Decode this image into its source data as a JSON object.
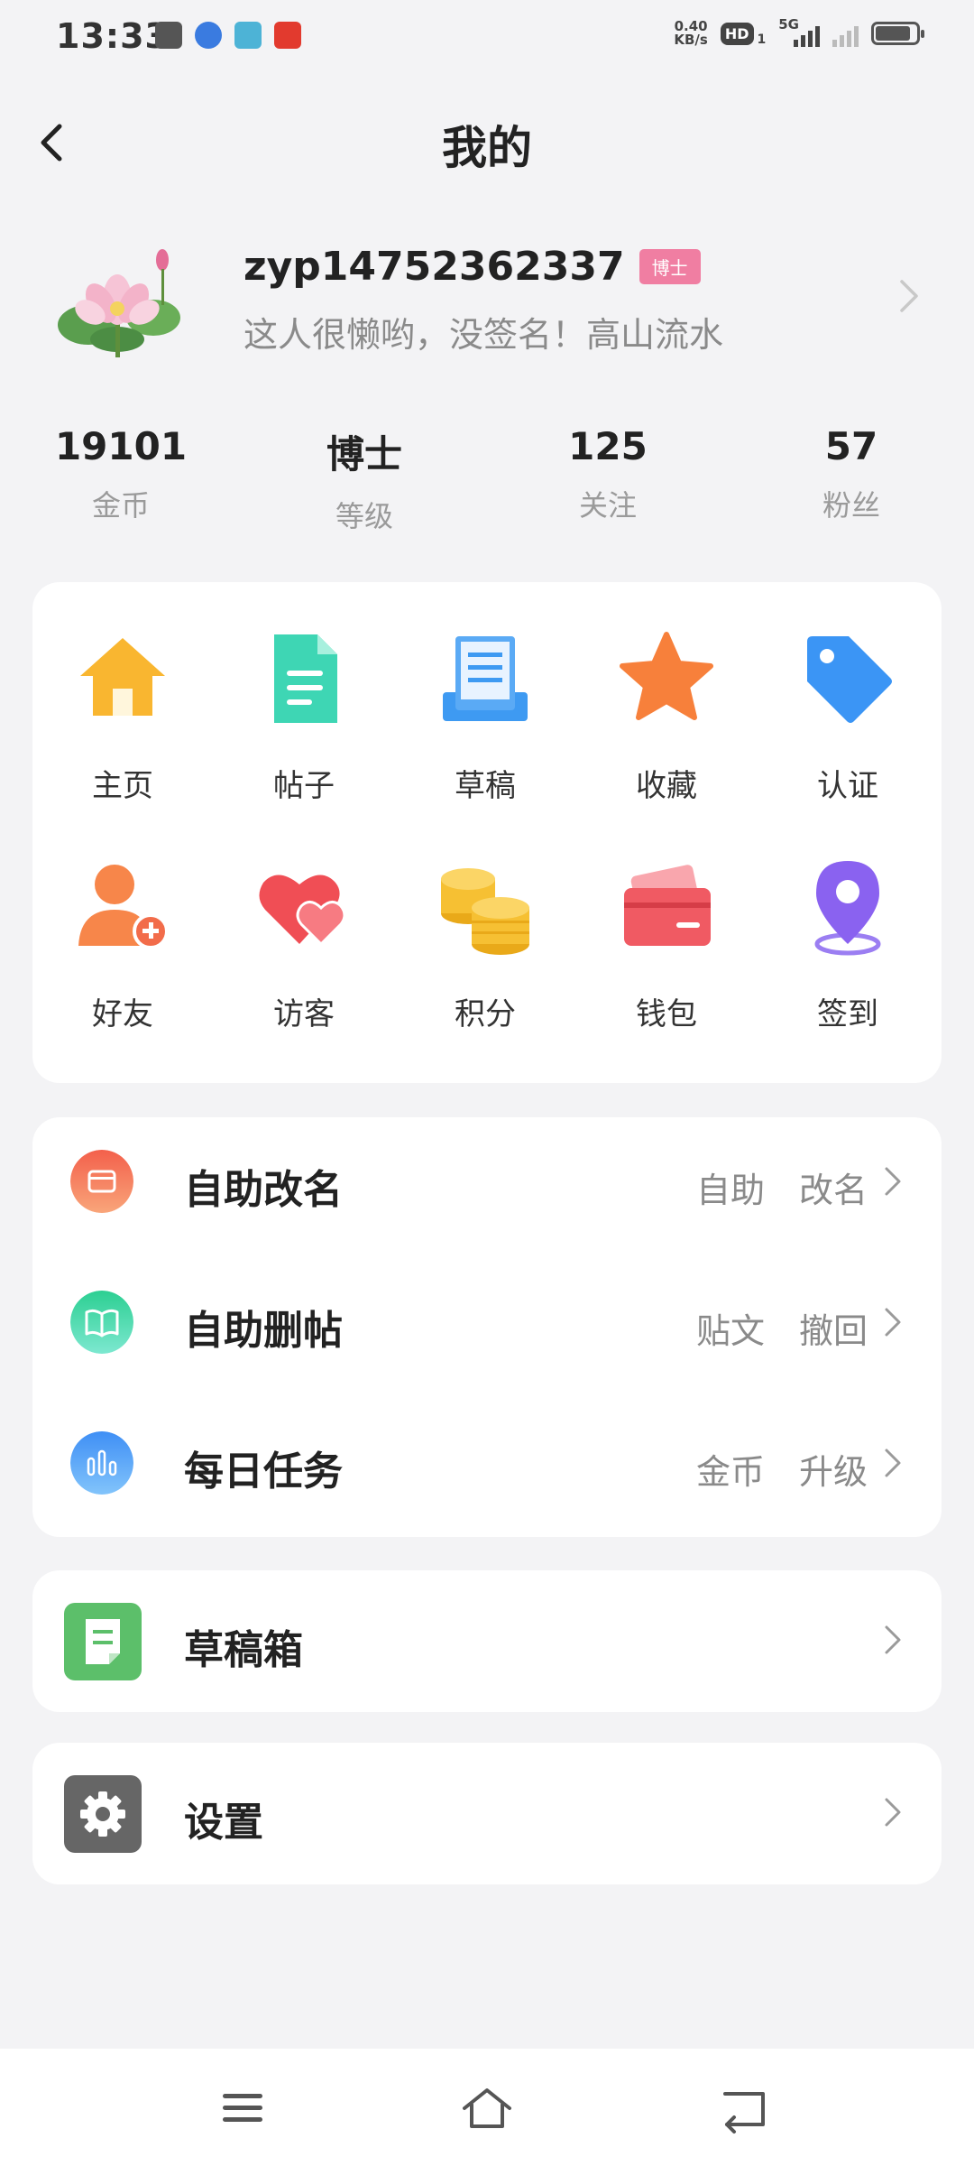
{
  "status_bar": {
    "time": "13:33",
    "net_speed_value": "0.40",
    "net_speed_unit": "KB/s",
    "hd_label": "HD",
    "hd_sub": "1",
    "network_type": "5G"
  },
  "header": {
    "title": "我的",
    "back_icon": "chevron-left-icon"
  },
  "profile": {
    "username": "zyp14752362337",
    "level_badge": "博士",
    "signature": "这人很懒哟，没签名！高山流水",
    "avatar_icon": "lotus-flower"
  },
  "stats": [
    {
      "value": "19101",
      "label": "金币"
    },
    {
      "value": "博士",
      "label": "等级"
    },
    {
      "value": "125",
      "label": "关注"
    },
    {
      "value": "57",
      "label": "粉丝"
    }
  ],
  "grid": [
    {
      "label": "主页",
      "icon": "house-icon"
    },
    {
      "label": "帖子",
      "icon": "document-icon"
    },
    {
      "label": "草稿",
      "icon": "draft-icon"
    },
    {
      "label": "收藏",
      "icon": "star-icon"
    },
    {
      "label": "认证",
      "icon": "tag-icon"
    },
    {
      "label": "好友",
      "icon": "add-friend-icon"
    },
    {
      "label": "访客",
      "icon": "hearts-icon"
    },
    {
      "label": "积分",
      "icon": "coins-icon"
    },
    {
      "label": "钱包",
      "icon": "wallet-icon"
    },
    {
      "label": "签到",
      "icon": "location-pin-icon"
    }
  ],
  "list": [
    {
      "title": "自助改名",
      "extra": [
        "自助",
        "改名"
      ],
      "icon": "card-icon",
      "color": "#f26c5a"
    },
    {
      "title": "自助删帖",
      "extra": [
        "贴文",
        "撤回"
      ],
      "icon": "book-icon",
      "color": "#3fd3a2"
    },
    {
      "title": "每日任务",
      "extra": [
        "金币",
        "升级"
      ],
      "icon": "bar-chart-icon",
      "color": "#4f9cf6"
    }
  ],
  "draft_box": {
    "title": "草稿箱",
    "icon": "note-icon",
    "color": "#5cbf6a"
  },
  "settings": {
    "title": "设置",
    "icon": "gear-icon",
    "color": "#666666"
  },
  "nav": {
    "menu_icon": "menu-icon",
    "home_icon": "home-outline-icon",
    "back_icon": "return-icon"
  }
}
